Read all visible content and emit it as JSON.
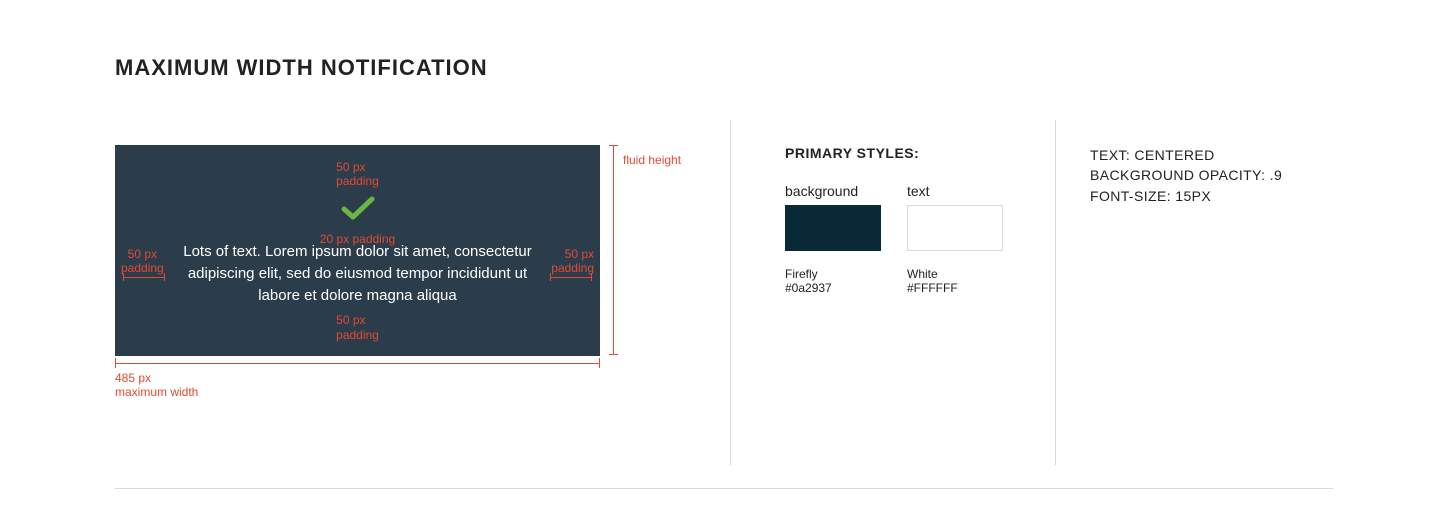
{
  "heading": "MAXIMUM WIDTH NOTIFICATION",
  "notification": {
    "body": "Lots of text. Lorem ipsum dolor sit amet, consectetur adipiscing elit, sed do eiusmod tempor incididunt ut labore et dolore magna aliqua"
  },
  "annotations": {
    "padding_top": "50 px\npadding",
    "padding_icon_gap": "20 px padding",
    "padding_left": "50 px\npadding",
    "padding_right": "50 px\npadding",
    "padding_bottom": "50 px\npadding",
    "max_width": "485 px\nmaximum width",
    "fluid_height": "fluid height"
  },
  "primary_styles": {
    "title": "PRIMARY STYLES:",
    "background": {
      "label": "background",
      "name": "Firefly",
      "hex": "#0a2937"
    },
    "text": {
      "label": "text",
      "name": "White",
      "hex": "#FFFFFF"
    }
  },
  "style_rules": {
    "line1": "TEXT: CENTERED",
    "line2": "BACKGROUND OPACITY: .9",
    "line3": "FONT-SIZE: 15PX"
  }
}
